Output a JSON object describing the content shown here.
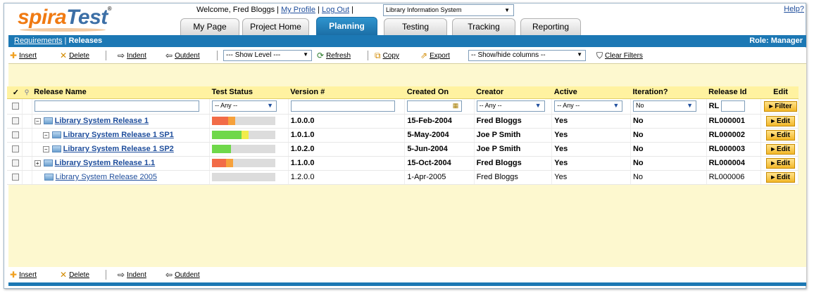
{
  "header": {
    "logo_a": "spira",
    "logo_b": "Test",
    "logo_reg": "®",
    "welcome": "Welcome, Fred Bloggs",
    "sep1": " | ",
    "my_profile": "My Profile",
    "sep2": " | ",
    "log_out": "Log Out",
    "sep3": " | ",
    "project": "Library Information System",
    "help": "Help?"
  },
  "tabs": [
    {
      "label": "My Page"
    },
    {
      "label": "Project Home"
    },
    {
      "label": "Planning"
    },
    {
      "label": "Testing"
    },
    {
      "label": "Tracking"
    },
    {
      "label": "Reporting"
    }
  ],
  "breadcrumb": {
    "requirements": "Requirements",
    "sep": " | ",
    "releases": "Releases",
    "role": "Role: Manager"
  },
  "toolbar": {
    "insert": "Insert",
    "delete": "Delete",
    "indent": "Indent",
    "outdent": "Outdent",
    "show_level": "--- Show Level ---",
    "refresh": "Refresh",
    "copy": "Copy",
    "export": "Export",
    "show_hide": "-- Show/hide columns --",
    "clear_filters": "Clear Filters"
  },
  "grid": {
    "columns": {
      "check": "✓",
      "name": "Release Name",
      "test_status": "Test Status",
      "version": "Version #",
      "created": "Created On",
      "creator": "Creator",
      "active": "Active",
      "iteration": "Iteration?",
      "release_id": "Release Id",
      "edit": "Edit"
    },
    "filters": {
      "test_status": "-- Any --",
      "creator": "-- Any --",
      "active": "-- Any --",
      "iteration": "No",
      "release_id_prefix": "RL",
      "filter_button": "Filter"
    },
    "rows": [
      {
        "toggle": "−",
        "name": "Library System Release 1",
        "version": "1.0.0.0",
        "created": "15-Feb-2004",
        "creator": "Fred Bloggs",
        "active": "Yes",
        "iteration": "No",
        "id": "RL000001",
        "edit": "Edit"
      },
      {
        "toggle": "−",
        "name": "Library System Release 1 SP1",
        "version": "1.0.1.0",
        "created": "5-May-2004",
        "creator": "Joe P Smith",
        "active": "Yes",
        "iteration": "No",
        "id": "RL000002",
        "edit": "Edit"
      },
      {
        "toggle": "−",
        "name": "Library System Release 1 SP2",
        "version": "1.0.2.0",
        "created": "5-Jun-2004",
        "creator": "Joe P Smith",
        "active": "Yes",
        "iteration": "No",
        "id": "RL000003",
        "edit": "Edit"
      },
      {
        "toggle": "+",
        "name": "Library System Release 1.1",
        "version": "1.1.0.0",
        "created": "15-Oct-2004",
        "creator": "Fred Bloggs",
        "active": "Yes",
        "iteration": "No",
        "id": "RL000004",
        "edit": "Edit"
      },
      {
        "toggle": "",
        "name": "Library System Release 2005",
        "version": "1.2.0.0",
        "created": "1-Apr-2005",
        "creator": "Fred Bloggs",
        "active": "Yes",
        "iteration": "No",
        "id": "RL000006",
        "edit": "Edit"
      }
    ],
    "status_colors": {
      "red": "#f26b47",
      "orange": "#f6a13b",
      "green": "#6fd84a",
      "yellow": "#f2ec4a",
      "none": "#dcdcdc"
    }
  }
}
